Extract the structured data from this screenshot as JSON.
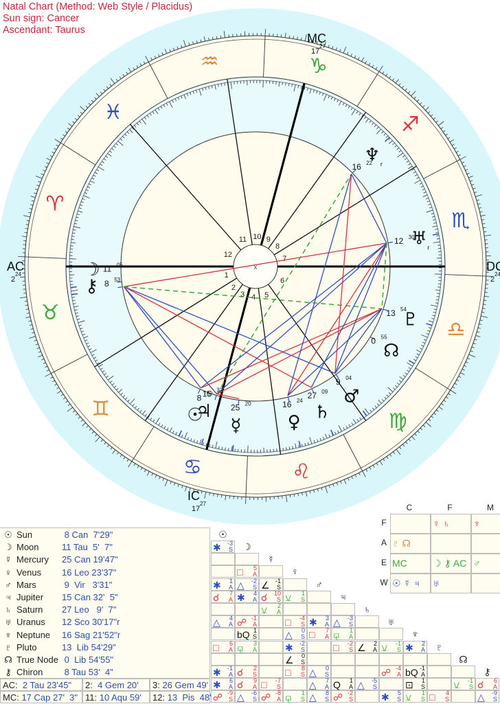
{
  "header": {
    "title": "Natal Chart  (Method: Web Style / Placidus)",
    "sun_sign": "Sun sign: Cancer",
    "ascendant": "Ascendant: Taurus"
  },
  "colors": {
    "fire": "#d8323c",
    "earth": "#3aa83a",
    "air": "#e08a38",
    "water": "#2f4fbf",
    "aspect_hard": "#d8323c",
    "aspect_soft": "#2f4fbf",
    "aspect_minor": "#3aa83a",
    "outer_bg": "#d9f6fb",
    "ring_bg": "#fffcee",
    "header_text": "#c8283a",
    "value_text": "#2c4fa8"
  },
  "wheel": {
    "angles": {
      "ac": {
        "label": "AC",
        "deg": "2",
        "min": "24"
      },
      "dc": {
        "label": "DC",
        "deg": "2",
        "min": "24"
      },
      "mc": {
        "label": "MC",
        "deg": "17",
        "min": "27"
      },
      "ic": {
        "label": "IC",
        "deg": "17",
        "min": "27"
      }
    },
    "ascendant_longitude": 32.396,
    "house_cusps": [
      32.396,
      64.333,
      86.817,
      107.45,
      130,
      158,
      212.396,
      244.333,
      266.817,
      287.45,
      310.983,
      343.8
    ],
    "house_numbers": [
      "1",
      "2",
      "3",
      "4",
      "5",
      "6",
      "7",
      "8",
      "9",
      "10",
      "11",
      "12"
    ],
    "signs": [
      {
        "name": "Aries",
        "glyph": "♈",
        "element": "fire"
      },
      {
        "name": "Taurus",
        "glyph": "♉",
        "element": "earth"
      },
      {
        "name": "Gemini",
        "glyph": "♊",
        "element": "air"
      },
      {
        "name": "Cancer",
        "glyph": "♋",
        "element": "water"
      },
      {
        "name": "Leo",
        "glyph": "♌",
        "element": "fire"
      },
      {
        "name": "Virgo",
        "glyph": "♍",
        "element": "earth"
      },
      {
        "name": "Libra",
        "glyph": "♎",
        "element": "air"
      },
      {
        "name": "Scorpio",
        "glyph": "♏",
        "element": "water"
      },
      {
        "name": "Sagittarius",
        "glyph": "♐",
        "element": "fire"
      },
      {
        "name": "Capricorn",
        "glyph": "♑",
        "element": "earth"
      },
      {
        "name": "Aquarius",
        "glyph": "♒",
        "element": "air"
      },
      {
        "name": "Pisces",
        "glyph": "♓",
        "element": "water"
      }
    ],
    "planets": [
      {
        "key": "sun",
        "glyph": "☉",
        "lon": 98.125,
        "deg": "8",
        "min": "07",
        "retro": ""
      },
      {
        "key": "moon",
        "glyph": "☽",
        "lon": 41.085,
        "deg": "11",
        "min": "05",
        "retro": ""
      },
      {
        "key": "mercury",
        "glyph": "☿",
        "lon": 115.33,
        "deg": "25",
        "min": "20",
        "retro": ""
      },
      {
        "key": "venus",
        "glyph": "♀",
        "lon": 136.39,
        "deg": "16",
        "min": "24",
        "retro": ""
      },
      {
        "key": "mars",
        "glyph": "♂",
        "lon": 159.06,
        "deg": "9",
        "min": "04",
        "retro": ""
      },
      {
        "key": "jupiter",
        "glyph": "♃",
        "lon": 105.53,
        "deg": "15",
        "min": "32",
        "retro": ""
      },
      {
        "key": "saturn",
        "glyph": "♄",
        "lon": 147.15,
        "deg": "27",
        "min": "09",
        "retro": ""
      },
      {
        "key": "uranus",
        "glyph": "♅",
        "lon": 222.5,
        "deg": "12",
        "min": "30",
        "retro": "r"
      },
      {
        "key": "neptune",
        "glyph": "♆",
        "lon": 256.36,
        "deg": "16",
        "min": "22",
        "retro": "r"
      },
      {
        "key": "pluto",
        "glyph": "♇",
        "lon": 193.91,
        "deg": "13",
        "min": "54",
        "retro": ""
      },
      {
        "key": "node",
        "glyph": "☊",
        "lon": 180.915,
        "deg": "0",
        "min": "55",
        "retro": ""
      },
      {
        "key": "chiron",
        "glyph": "⚷",
        "lon": 38.885,
        "deg": "8",
        "min": "53",
        "retro": ""
      }
    ],
    "aspect_lines": [
      {
        "a": "moon",
        "b": "uranus",
        "type": "hard"
      },
      {
        "a": "moon",
        "b": "mars",
        "type": "soft"
      },
      {
        "a": "moon",
        "b": "jupiter",
        "type": "soft"
      },
      {
        "a": "moon",
        "b": "sun",
        "type": "soft"
      },
      {
        "a": "moon",
        "b": "saturn",
        "type": "hard"
      },
      {
        "a": "moon",
        "b": "pluto",
        "type": "minor"
      },
      {
        "a": "sun",
        "b": "uranus",
        "type": "soft"
      },
      {
        "a": "sun",
        "b": "pluto",
        "type": "hard"
      },
      {
        "a": "jupiter",
        "b": "uranus",
        "type": "soft"
      },
      {
        "a": "jupiter",
        "b": "pluto",
        "type": "hard"
      },
      {
        "a": "jupiter",
        "b": "neptune",
        "type": "minor"
      },
      {
        "a": "mercury",
        "b": "jupiter",
        "type": "hard"
      },
      {
        "a": "venus",
        "b": "neptune",
        "type": "soft"
      },
      {
        "a": "venus",
        "b": "uranus",
        "type": "hard"
      },
      {
        "a": "venus",
        "b": "pluto",
        "type": "soft"
      },
      {
        "a": "mars",
        "b": "neptune",
        "type": "hard"
      },
      {
        "a": "mars",
        "b": "uranus",
        "type": "soft"
      },
      {
        "a": "mars",
        "b": "pluto",
        "type": "soft"
      },
      {
        "a": "saturn",
        "b": "uranus",
        "type": "soft"
      },
      {
        "a": "uranus",
        "b": "neptune",
        "type": "soft"
      },
      {
        "a": "uranus",
        "b": "pluto",
        "type": "minor"
      }
    ]
  },
  "planet_table": [
    {
      "glyph": "☉",
      "name": "Sun",
      "pos": " 8 Can  7'29\""
    },
    {
      "glyph": "☽",
      "name": "Moon",
      "pos": "11 Tau  5'  7\""
    },
    {
      "glyph": "☿",
      "name": "Mercury",
      "pos": "25 Can 19'47\""
    },
    {
      "glyph": "♀",
      "name": "Venus",
      "pos": "16 Leo 23'37\""
    },
    {
      "glyph": "♂",
      "name": "Mars",
      "pos": " 9  Vir   3'31\""
    },
    {
      "glyph": "♃",
      "name": "Jupiter",
      "pos": "15 Can 32'  5\""
    },
    {
      "glyph": "♄",
      "name": "Saturn",
      "pos": "27 Leo   9'  7\""
    },
    {
      "glyph": "♅",
      "name": "Uranus",
      "pos": "12 Sco 30'17\"r"
    },
    {
      "glyph": "♆",
      "name": "Neptune",
      "pos": "16 Sag 21'52\"r"
    },
    {
      "glyph": "♇",
      "name": "Pluto",
      "pos": "13  Lib 54'29\""
    },
    {
      "glyph": "☊",
      "name": "True Node",
      "pos": " 0  Lib 54'55\""
    },
    {
      "glyph": "⚷",
      "name": "Chiron",
      "pos": " 8 Tau 53'  4\""
    }
  ],
  "house_table": [
    [
      {
        "label": "AC:",
        "value": "  2 Tau 23'45\""
      },
      {
        "label": "2:",
        "value": "  4 Gem 20'"
      },
      {
        "label": "3:",
        "value": " 26 Gem 49'"
      }
    ],
    [
      {
        "label": "MC:",
        "value": " 17 Cap 27'  3\""
      },
      {
        "label": "11:",
        "value": " 10 Aqu 59'"
      },
      {
        "label": "12:",
        "value": " 13  Pis  48'"
      }
    ]
  ],
  "aspect_grid": {
    "headers": [
      "☉",
      "☽",
      "☿",
      "♀",
      "♂",
      "♃",
      "♄",
      "♅",
      "♆",
      "♇",
      "☊",
      "⚷"
    ],
    "rows": [
      {
        "row": "moon",
        "cells": [
          {
            "c": 0,
            "sym": "✱",
            "orb": "-3",
            "sa": "S",
            "col": "soft"
          }
        ]
      },
      {
        "row": "mercury",
        "cells": []
      },
      {
        "row": "venus",
        "cells": [
          {
            "c": 1,
            "sym": "□",
            "orb": "5",
            "sa": "A",
            "col": "hard"
          }
        ]
      },
      {
        "row": "mars",
        "cells": [
          {
            "c": 0,
            "sym": "✱",
            "orb": "1",
            "sa": "A",
            "col": "soft"
          },
          {
            "c": 1,
            "sym": "△",
            "orb": "-2",
            "sa": "S",
            "col": "soft"
          },
          {
            "c": 2,
            "sym": "∠",
            "orb": "-1",
            "sa": "S",
            "col": "neutral"
          }
        ]
      },
      {
        "row": "jupiter",
        "cells": [
          {
            "c": 0,
            "sym": "☌",
            "orb": "7",
            "sa": "A",
            "col": "hard"
          },
          {
            "c": 1,
            "sym": "✱",
            "orb": "4",
            "sa": "A",
            "col": "soft"
          },
          {
            "c": 2,
            "sym": "☌",
            "orb": "10",
            "sa": "S",
            "col": "hard"
          },
          {
            "c": 3,
            "sym": "⚺",
            "orb": "1",
            "sa": "S",
            "col": "minor"
          }
        ]
      },
      {
        "row": "saturn",
        "cells": [
          {
            "c": 2,
            "sym": "⚺",
            "orb": "2",
            "sa": "A",
            "col": "minor"
          }
        ]
      },
      {
        "row": "uranus",
        "cells": [
          {
            "c": 0,
            "sym": "△",
            "orb": "4",
            "sa": "A",
            "col": "soft"
          },
          {
            "c": 1,
            "sym": "☍",
            "orb": "-1",
            "sa": "A",
            "col": "hard"
          },
          {
            "c": 3,
            "sym": "□",
            "orb": "-4",
            "sa": "S",
            "col": "hard"
          },
          {
            "c": 4,
            "sym": "✱",
            "orb": "3",
            "sa": "A",
            "col": "soft"
          },
          {
            "c": 5,
            "sym": "△",
            "orb": "-3",
            "sa": "S",
            "col": "soft"
          }
        ]
      },
      {
        "row": "neptune",
        "cells": [
          {
            "c": 1,
            "sym": "bQ",
            "orb": "1",
            "sa": "S",
            "col": "neutral"
          },
          {
            "c": 3,
            "sym": "△",
            "orb": "0",
            "sa": "S",
            "col": "soft"
          },
          {
            "c": 4,
            "sym": "□",
            "orb": "7",
            "sa": "A",
            "col": "hard"
          },
          {
            "c": 5,
            "sym": "⚼",
            "orb": "1",
            "sa": "A",
            "col": "minor"
          }
        ]
      },
      {
        "row": "pluto",
        "cells": [
          {
            "c": 0,
            "sym": "□",
            "orb": "6",
            "sa": "A",
            "col": "hard"
          },
          {
            "c": 1,
            "sym": "⚼",
            "orb": "3",
            "sa": "A",
            "col": "minor"
          },
          {
            "c": 3,
            "sym": "✱",
            "orb": "-2",
            "sa": "S",
            "col": "soft"
          },
          {
            "c": 5,
            "sym": "□",
            "orb": "-2",
            "sa": "S",
            "col": "hard"
          },
          {
            "c": 6,
            "sym": "∠",
            "orb": "2",
            "sa": "A",
            "col": "neutral"
          },
          {
            "c": 7,
            "sym": "⚺",
            "orb": "-1",
            "sa": "S",
            "col": "minor"
          },
          {
            "c": 8,
            "sym": "✱",
            "orb": "2",
            "sa": "A",
            "col": "soft"
          }
        ]
      },
      {
        "row": "node",
        "cells": [
          {
            "c": 3,
            "sym": "∠",
            "orb": "0",
            "sa": "S",
            "col": "neutral"
          }
        ]
      },
      {
        "row": "chiron",
        "cells": [
          {
            "c": 0,
            "sym": "✱",
            "orb": "-1",
            "sa": "A",
            "col": "soft"
          },
          {
            "c": 1,
            "sym": "☌",
            "orb": "2",
            "sa": "S",
            "col": "hard"
          },
          {
            "c": 3,
            "sym": "□",
            "orb": "8",
            "sa": "S",
            "col": "hard"
          },
          {
            "c": 4,
            "sym": "△",
            "orb": "0",
            "sa": "S",
            "col": "soft"
          },
          {
            "c": 7,
            "sym": "☍",
            "orb": "-4",
            "sa": "A",
            "col": "hard"
          },
          {
            "c": 8,
            "sym": "bQ",
            "orb": "-1",
            "sa": "A",
            "col": "neutral"
          }
        ]
      },
      {
        "row": "ac",
        "cells": [
          {
            "c": 0,
            "sym": "✱",
            "orb": "6",
            "sa": "A",
            "col": "soft"
          },
          {
            "c": 1,
            "sym": "☌",
            "orb": "9",
            "sa": "A",
            "col": "hard"
          },
          {
            "c": 2,
            "sym": "□",
            "orb": "-7",
            "sa": "S",
            "col": "hard"
          },
          {
            "c": 4,
            "sym": "△",
            "orb": "7",
            "sa": "A",
            "col": "soft"
          },
          {
            "c": 5,
            "sym": "Q",
            "orb": "1",
            "sa": "A",
            "col": "neutral"
          },
          {
            "c": 6,
            "sym": "△",
            "orb": "-5",
            "sa": "S",
            "col": "soft"
          },
          {
            "c": 8,
            "sym": "⊡",
            "orb": "1",
            "sa": "S",
            "col": "neutral"
          },
          {
            "c": 10,
            "sym": "⚺",
            "orb": "-1",
            "sa": "S",
            "col": "minor"
          },
          {
            "c": 11,
            "sym": "☌",
            "orb": "6",
            "sa": "A",
            "col": "hard"
          }
        ]
      },
      {
        "row": "mc",
        "cells": [
          {
            "c": 0,
            "sym": "☍",
            "orb": "-9",
            "sa": "S",
            "col": "hard"
          },
          {
            "c": 1,
            "sym": "△",
            "orb": "-6",
            "sa": "S",
            "col": "soft"
          },
          {
            "c": 2,
            "sym": "☍",
            "orb": "-8",
            "sa": "A",
            "col": "hard"
          },
          {
            "c": 3,
            "sym": "⚼",
            "orb": "1",
            "sa": "S",
            "col": "minor"
          },
          {
            "c": 4,
            "sym": "△",
            "orb": "8",
            "sa": "S",
            "col": "soft"
          },
          {
            "c": 5,
            "sym": "☍",
            "orb": "-2",
            "sa": "S",
            "col": "hard"
          },
          {
            "c": 7,
            "sym": "✱",
            "orb": "5",
            "sa": "S",
            "col": "soft"
          },
          {
            "c": 8,
            "sym": "⚺",
            "orb": "1",
            "sa": "S",
            "col": "minor"
          },
          {
            "c": 9,
            "sym": "□",
            "orb": "4",
            "sa": "S",
            "col": "hard"
          },
          {
            "c": 11,
            "sym": "△",
            "orb": "-9",
            "sa": "S",
            "col": "soft"
          }
        ]
      }
    ]
  },
  "element_table": {
    "columns": [
      "C",
      "F",
      "M"
    ],
    "rows": [
      "F",
      "A",
      "E",
      "W"
    ],
    "cells": [
      [
        "",
        "♀ ♄",
        "♆"
      ],
      [
        "♇ ☊",
        "",
        ""
      ],
      [
        "MC",
        "☽ ⚷ AC",
        "♂"
      ],
      [
        "☉ ☿ ♃",
        "♅",
        ""
      ]
    ],
    "row_colors": [
      "#d8323c",
      "#e08a38",
      "#3aa83a",
      "#2f4fbf"
    ]
  }
}
